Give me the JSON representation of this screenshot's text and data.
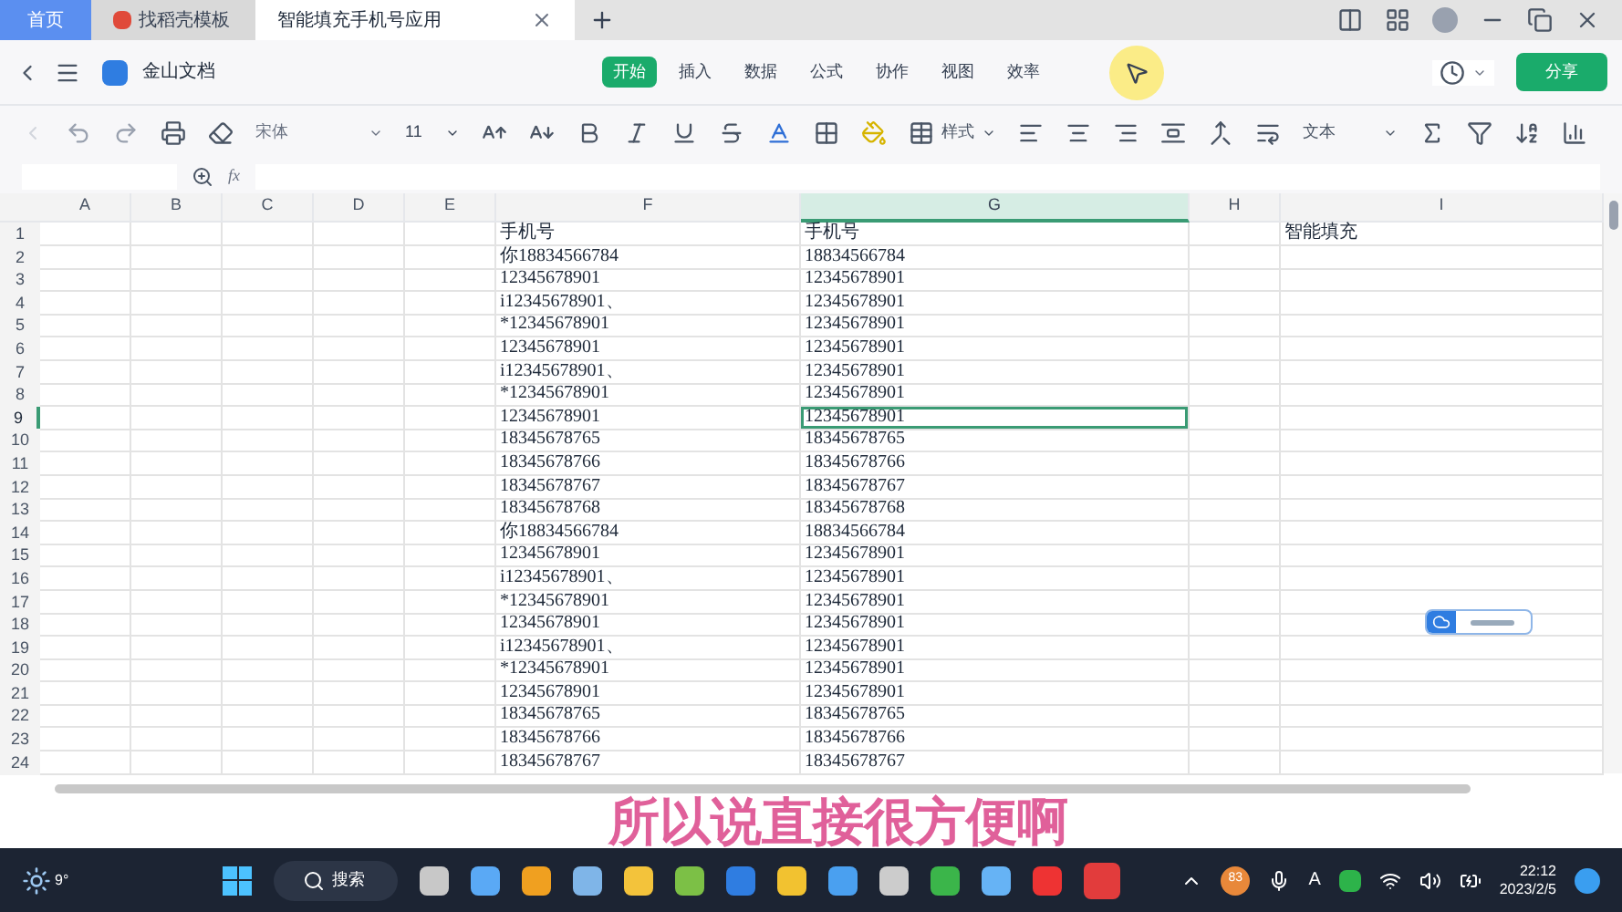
{
  "browser_tabs": [
    {
      "label": "首页",
      "kind": "home",
      "selected": false
    },
    {
      "label": "找稻壳模板",
      "kind": "template",
      "selected": false
    },
    {
      "label": "智能填充手机号应用",
      "kind": "doc",
      "selected": true
    }
  ],
  "app": {
    "name": "金山文档",
    "menu": [
      {
        "label": "开始",
        "selected": true
      },
      {
        "label": "插入",
        "selected": false
      },
      {
        "label": "数据",
        "selected": false
      },
      {
        "label": "公式",
        "selected": false
      },
      {
        "label": "协作",
        "selected": false
      },
      {
        "label": "视图",
        "selected": false
      },
      {
        "label": "效率",
        "selected": false
      }
    ],
    "share": "分享"
  },
  "toolbar": {
    "function_label": "fx",
    "font": "宋体",
    "size": "11",
    "style": "样式",
    "format": "文本"
  },
  "sheet": {
    "columns": [
      {
        "label": "A",
        "selected": false
      },
      {
        "label": "B",
        "selected": false
      },
      {
        "label": "C",
        "selected": false
      },
      {
        "label": "D",
        "selected": false
      },
      {
        "label": "E",
        "selected": false
      },
      {
        "label": "F",
        "selected": false
      },
      {
        "label": "G",
        "selected": true
      },
      {
        "label": "H",
        "selected": false
      },
      {
        "label": "I",
        "selected": false
      }
    ],
    "rows": [
      {
        "number": "1",
        "selected": false,
        "f": "手机号",
        "g": "手机号",
        "i": "智能填充"
      },
      {
        "number": "2",
        "selected": false,
        "f": "你18834566784",
        "g": "18834566784"
      },
      {
        "number": "3",
        "selected": false,
        "f": "12345678901",
        "g": "12345678901"
      },
      {
        "number": "4",
        "selected": false,
        "f": "i12345678901、",
        "g": "12345678901"
      },
      {
        "number": "5",
        "selected": false,
        "f": "*12345678901",
        "g": "12345678901"
      },
      {
        "number": "6",
        "selected": false,
        "f": "12345678901",
        "g": "12345678901"
      },
      {
        "number": "7",
        "selected": false,
        "f": "i12345678901、",
        "g": "12345678901"
      },
      {
        "number": "8",
        "selected": false,
        "f": "*12345678901",
        "g": "12345678901"
      },
      {
        "number": "9",
        "selected": true,
        "f": "12345678901",
        "g": "12345678901"
      },
      {
        "number": "10",
        "selected": false,
        "f": "18345678765",
        "g": "18345678765"
      },
      {
        "number": "11",
        "selected": false,
        "f": "18345678766",
        "g": "18345678766"
      },
      {
        "number": "12",
        "selected": false,
        "f": "18345678767",
        "g": "18345678767"
      },
      {
        "number": "13",
        "selected": false,
        "f": "18345678768",
        "g": "18345678768"
      },
      {
        "number": "14",
        "selected": false,
        "f": "你18834566784",
        "g": "18834566784"
      },
      {
        "number": "15",
        "selected": false,
        "f": "12345678901",
        "g": "12345678901"
      },
      {
        "number": "16",
        "selected": false,
        "f": "i12345678901、",
        "g": "12345678901"
      },
      {
        "number": "17",
        "selected": false,
        "f": "*12345678901",
        "g": "12345678901"
      },
      {
        "number": "18",
        "selected": false,
        "f": "12345678901",
        "g": "12345678901"
      },
      {
        "number": "19",
        "selected": false,
        "f": "i12345678901、",
        "g": "12345678901"
      },
      {
        "number": "20",
        "selected": false,
        "f": "*12345678901",
        "g": "12345678901"
      },
      {
        "number": "21",
        "selected": false,
        "f": "12345678901",
        "g": "12345678901"
      },
      {
        "number": "22",
        "selected": false,
        "f": "18345678765",
        "g": "18345678765"
      },
      {
        "number": "23",
        "selected": false,
        "f": "18345678766",
        "g": "18345678766"
      },
      {
        "number": "24",
        "selected": false,
        "f": "18345678767",
        "g": "18345678767"
      }
    ]
  },
  "subtitle": "所以说直接很方便啊",
  "taskbar": {
    "weather": "9°",
    "search": "搜索",
    "badge": "83",
    "input": "A",
    "time": "22:12",
    "date": "2023/2/5"
  }
}
